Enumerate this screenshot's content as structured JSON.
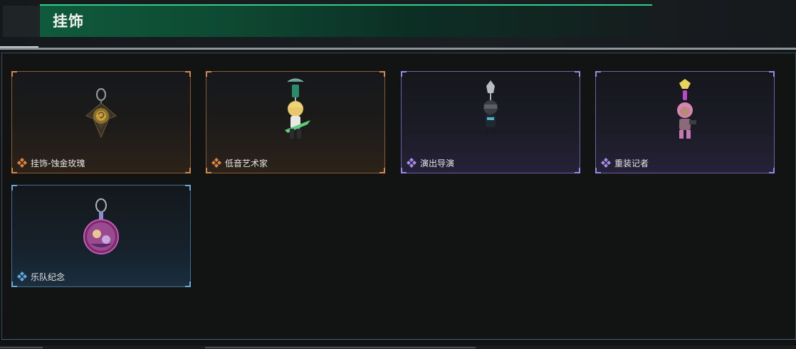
{
  "header": {
    "title": "挂饰"
  },
  "colors": {
    "accent_green": "#2fcf8a",
    "rarity_orange": "#e0833e",
    "rarity_purple": "#a48ee8",
    "rarity_blue": "#5fa8e0"
  },
  "items": [
    {
      "label": "挂饰-蚀金玫瑰",
      "rarity": "orange",
      "icon": "rose-charm-icon"
    },
    {
      "label": "低音艺术家",
      "rarity": "orange",
      "icon": "bassist-charm-icon"
    },
    {
      "label": "演出导演",
      "rarity": "purple",
      "icon": "director-charm-icon"
    },
    {
      "label": "重装记者",
      "rarity": "purple",
      "icon": "reporter-charm-icon"
    },
    {
      "label": "乐队纪念",
      "rarity": "blue",
      "icon": "band-badge-charm-icon"
    }
  ]
}
